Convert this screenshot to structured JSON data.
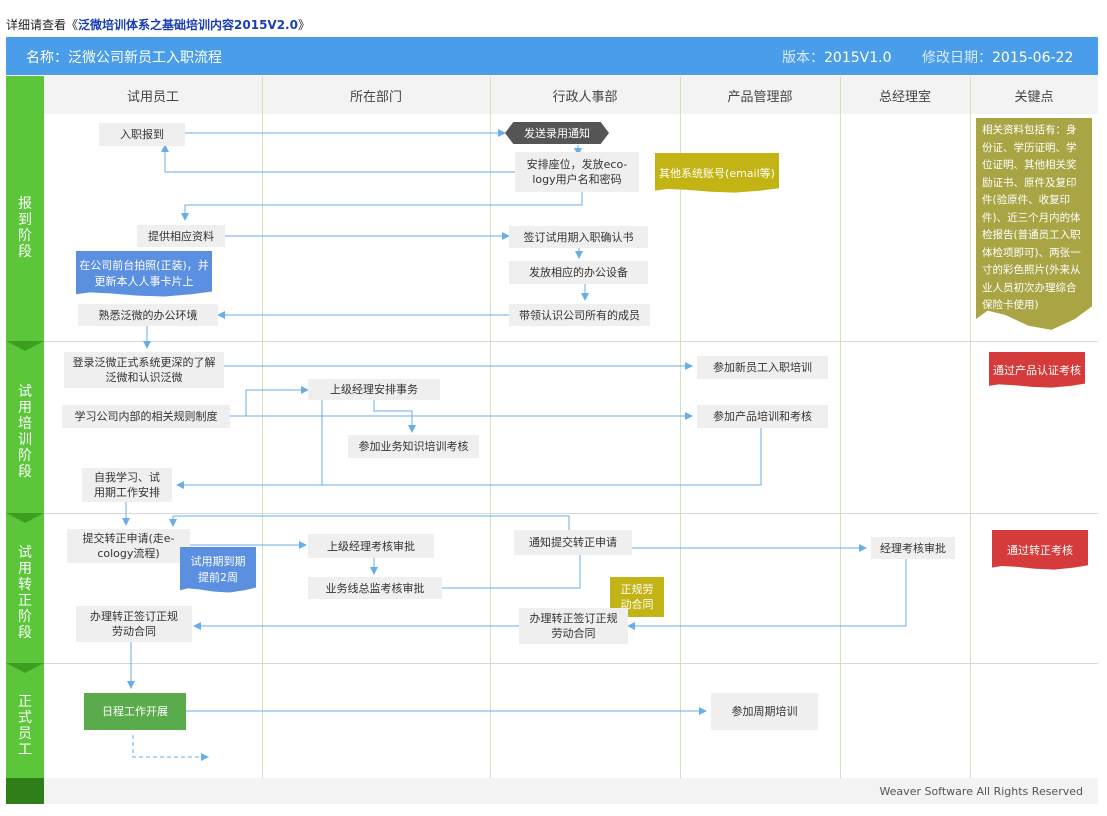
{
  "top": {
    "prefix": "详细请查看《",
    "link": "泛微培训体系之基础培训内容2015V2.0",
    "suffix": "》"
  },
  "header": {
    "title": "名称：泛微公司新员工入职流程",
    "version_label": "版本：",
    "version": "2015V1.0",
    "date_label": "修改日期：",
    "date": "2015-06-22"
  },
  "columns": [
    "试用员工",
    "所在部门",
    "行政人事部",
    "产品管理部",
    "总经理室",
    "关键点"
  ],
  "stages": [
    "报到阶段",
    "试用培训阶段",
    "试用转正阶段",
    "正式员工"
  ],
  "nodes": {
    "report_in": "入职报到",
    "send_notice": "发送录用通知",
    "arrange_seat": "安排座位，发放eco-logy用户名和密码",
    "other_accounts": "其他系统账号(email等)",
    "provide_docs": "提供相应资料",
    "sign_confirm": "签订试用期入职确认书",
    "issue_equipment": "发放相应的办公设备",
    "photo_note": "在公司前台拍照(正装)，并更新本人人事卡片上",
    "lead_meet": "带领认识公司所有的成员",
    "familiarize": "熟悉泛微的办公环境",
    "login_system": "登录泛微正式系统更深的了解泛微和认识泛微",
    "new_training": "参加新员工入职培训",
    "manager_arrange": "上级经理安排事务",
    "learn_rules": "学习公司内部的相关规则制度",
    "product_training": "参加产品培训和考核",
    "business_exam": "参加业务知识培训考核",
    "self_study": "自我学习、试用期工作安排",
    "submit_request": "提交转正申请(走e-cology流程)",
    "trial_due_note": "试用期到期提前2周",
    "manager_review": "上级经理考核审批",
    "notify_submit": "通知提交转正申请",
    "gm_review": "经理考核审批",
    "line_director": "业务线总监考核审批",
    "formal_contract_note": "正规劳动合同",
    "hr_process": "办理转正签订正规劳动合同",
    "emp_process": "办理转正签订正规劳动合同",
    "daily_work": "日程工作开展",
    "periodic_training": "参加周期培训"
  },
  "keypoints": {
    "docs": "相关资料包括有：身份证、学历证明、学位证明、其他相关奖励证书、原件及复印件(验原件、收复印件)、近三个月内的体检报告(普通员工入职体检项即可)、两张一寸的彩色照片(外来从业人员初次办理综合保险卡使用)",
    "cert_exam": "通过产品认证考核",
    "regular_exam": "通过转正考核"
  },
  "footer": "Weaver Software All Rights Reserved",
  "colors": {
    "header": "#4a9de8",
    "stage": "#5bc63a",
    "arrow": "#6aaee8"
  }
}
